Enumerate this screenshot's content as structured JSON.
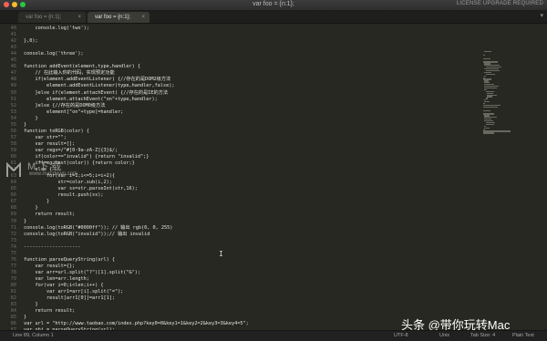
{
  "window": {
    "title": "var foo = {n:1};",
    "license": "LICENSE UPGRADE REQUIRED"
  },
  "tabs": [
    {
      "label": "var foo = {n:1};",
      "close": "×"
    },
    {
      "label": "var foo = {n:1};",
      "close": "×"
    }
  ],
  "tab_dropdown": "▾",
  "lines": [
    {
      "n": "40",
      "text": "    console.log('two');"
    },
    {
      "n": "41",
      "text": ""
    },
    {
      "n": "42",
      "text": "},0);"
    },
    {
      "n": "43",
      "text": ""
    },
    {
      "n": "44",
      "text": "console.log('three');"
    },
    {
      "n": "45",
      "text": ""
    },
    {
      "n": "46",
      "text": "function addEvent(element,type,handler) {"
    },
    {
      "n": "47",
      "text": "    // 在此输入你的代码，实现预定功能"
    },
    {
      "n": "48",
      "text": "    if(element.addEventListener) {//存在的是DOM2级方法"
    },
    {
      "n": "49",
      "text": "        element.addEventListener(type,handler,false);"
    },
    {
      "n": "50",
      "text": "    }else if(element.attachEvent) {//存在的是IE的方法"
    },
    {
      "n": "51",
      "text": "        element.attachEvent(\"on\"+type,handler);"
    },
    {
      "n": "52",
      "text": "    }else {//存在的是DOM0级方法"
    },
    {
      "n": "53",
      "text": "        element[\"on\"+type]=handler;"
    },
    {
      "n": "54",
      "text": "    }"
    },
    {
      "n": "55",
      "text": "}"
    },
    {
      "n": "56",
      "text": "function toRGB(color) {"
    },
    {
      "n": "57",
      "text": "    var str=\"\";"
    },
    {
      "n": "58",
      "text": "    var result=[];"
    },
    {
      "n": "59",
      "text": "    var regx=/^#[0-9a-zA-Z]{3}$/;"
    },
    {
      "n": "60",
      "text": "    if(color==\"invalid\") {return \"invalid\";}"
    },
    {
      "n": "61",
      "text": "    if(reg.test(color)) {return color;}"
    },
    {
      "n": "62",
      "text": "    else {"
    },
    {
      "n": "63",
      "text": "        for(var i=1;i<=5;i=i+2){"
    },
    {
      "n": "64",
      "text": "            str=color.sub(i,2);"
    },
    {
      "n": "65",
      "text": "            var ss=str.parseInt(str,16);"
    },
    {
      "n": "66",
      "text": "            result.push(ss);"
    },
    {
      "n": "67",
      "text": "        }"
    },
    {
      "n": "68",
      "text": "    }"
    },
    {
      "n": "69",
      "text": "    return result;"
    },
    {
      "n": "70",
      "text": "}"
    },
    {
      "n": "71",
      "text": "console.log(toRGB(\"#0000ff\")); // 输出 rgb(0, 0, 255)"
    },
    {
      "n": "72",
      "text": "console.log(toRGB(\"invalid\"));// 输出 invalid"
    },
    {
      "n": "73",
      "text": ""
    },
    {
      "n": "74",
      "text": "--------------------"
    },
    {
      "n": "75",
      "text": ""
    },
    {
      "n": "76",
      "text": "function parseQueryString(url) {"
    },
    {
      "n": "77",
      "text": "    var result={};"
    },
    {
      "n": "78",
      "text": "    var arr=url.split(\"?\")[1].split(\"&\");"
    },
    {
      "n": "79",
      "text": "    var len=arr.length;"
    },
    {
      "n": "80",
      "text": "    for(var i=0;i<len;i++) {"
    },
    {
      "n": "81",
      "text": "        var arr1=arr[i].split(\"=\");"
    },
    {
      "n": "82",
      "text": "        result[arr1[0]]=arr1[1];"
    },
    {
      "n": "83",
      "text": "    }"
    },
    {
      "n": "84",
      "text": "    return result;"
    },
    {
      "n": "85",
      "text": "}"
    },
    {
      "n": "86",
      "text": "var url = \"http://www.taobao.com/index.php?key0=0&key1=1&key2=2&key3=3&key4=5\";"
    },
    {
      "n": "87",
      "text": "var obj = parseQueryString(url);"
    },
    {
      "n": "88",
      "text": ""
    }
  ],
  "cursor_icon": "I",
  "statusbar": {
    "position": "Line 89, Column 1",
    "encoding": "UTF-8",
    "line_endings": "Unix",
    "tab_size": "Tab Size: 4",
    "syntax": "Plain Text"
  },
  "watermark": {
    "text": "M 下 载",
    "sub": "www.macdown.com",
    "headline": "头条 @带你玩转Mac"
  },
  "colors": {
    "background": "#272822",
    "text": "#e6e4dc",
    "gutter_text": "#70705f"
  }
}
